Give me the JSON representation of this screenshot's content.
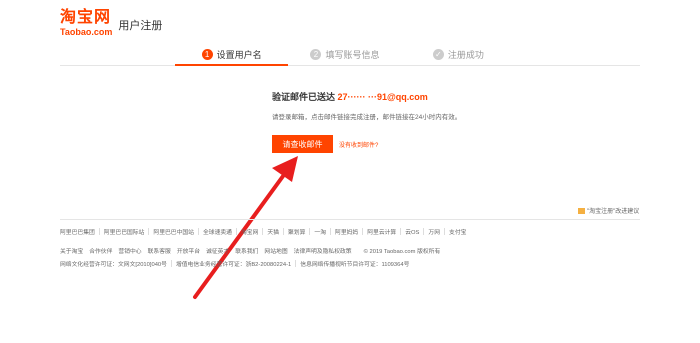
{
  "header": {
    "logo_cn": "淘宝网",
    "logo_en": "Taobao.com",
    "title": "用户注册"
  },
  "steps": [
    {
      "num": "1",
      "label": "设置用户名",
      "state": "active"
    },
    {
      "num": "2",
      "label": "填写账号信息",
      "state": "pending"
    },
    {
      "num": "✓",
      "label": "注册成功",
      "state": "pending"
    }
  ],
  "main": {
    "verify_prefix": "验证邮件已送达",
    "email": "27······ ···91@qq.com",
    "desc": "请登录邮箱，点击邮件链接完成注册，邮件链接在24小时内有效。",
    "button_label": "请查收邮件",
    "no_email_link": "没有收到邮件?"
  },
  "side_link": "\"淘宝注册\"改进建议",
  "footer": {
    "row1": [
      "阿里巴巴集团",
      "阿里巴巴国际站",
      "阿里巴巴中国站",
      "全球速卖通",
      "淘宝网",
      "天猫",
      "聚划算",
      "一淘",
      "阿里妈妈",
      "阿里云计算",
      "云OS",
      "万网",
      "支付宝"
    ],
    "row2_links": [
      "关于淘宝",
      "合作伙伴",
      "营销中心",
      "联系客服",
      "开放平台",
      "诚征英才",
      "联系我们",
      "网站地图",
      "法律声明及隐私权政策"
    ],
    "copyright": "© 2019 Taobao.com 版权所有",
    "row3": [
      "网络文化经营许可证：文网文[2010]040号",
      "增值电信业务经营许可证：浙B2-20080224-1",
      "信息网络传播视听节目许可证：1109364号"
    ]
  },
  "colors": {
    "brand": "#ff4400",
    "text": "#333333",
    "muted": "#999999"
  }
}
